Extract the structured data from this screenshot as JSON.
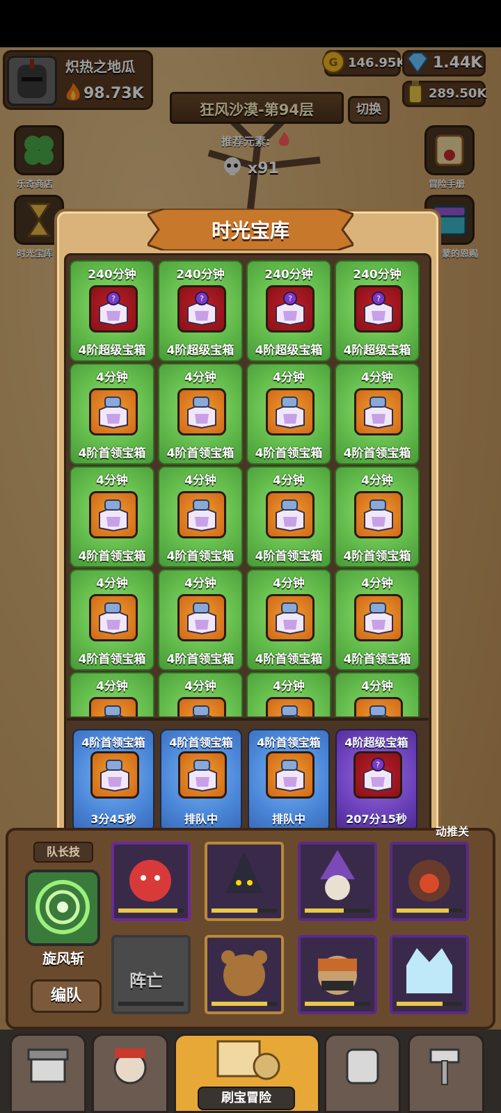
{
  "header": {
    "player_name": "炽热之地瓜",
    "power": "98.73K",
    "gold": "146.95K",
    "gems": "1.44K",
    "potion": "289.50K"
  },
  "stage": {
    "title": "狂风沙漠-第94层",
    "switch_label": "切换",
    "recommend_label": "推荐元素:",
    "skull_count": "x91"
  },
  "side_menu": {
    "left_top": "乐奇商店",
    "left_second": "时光宝库",
    "right_top": "冒险手册",
    "right_second": "卡蒙的恩赐"
  },
  "modal": {
    "title": "时光宝库",
    "grid": [
      {
        "time": "240分钟",
        "name": "4阶超级宝箱",
        "kind": "super"
      },
      {
        "time": "240分钟",
        "name": "4阶超级宝箱",
        "kind": "super"
      },
      {
        "time": "240分钟",
        "name": "4阶超级宝箱",
        "kind": "super"
      },
      {
        "time": "240分钟",
        "name": "4阶超级宝箱",
        "kind": "super"
      },
      {
        "time": "4分钟",
        "name": "4阶首领宝箱",
        "kind": "first"
      },
      {
        "time": "4分钟",
        "name": "4阶首领宝箱",
        "kind": "first"
      },
      {
        "time": "4分钟",
        "name": "4阶首领宝箱",
        "kind": "first"
      },
      {
        "time": "4分钟",
        "name": "4阶首领宝箱",
        "kind": "first"
      },
      {
        "time": "4分钟",
        "name": "4阶首领宝箱",
        "kind": "first"
      },
      {
        "time": "4分钟",
        "name": "4阶首领宝箱",
        "kind": "first"
      },
      {
        "time": "4分钟",
        "name": "4阶首领宝箱",
        "kind": "first"
      },
      {
        "time": "4分钟",
        "name": "4阶首领宝箱",
        "kind": "first"
      },
      {
        "time": "4分钟",
        "name": "4阶首领宝箱",
        "kind": "first"
      },
      {
        "time": "4分钟",
        "name": "4阶首领宝箱",
        "kind": "first"
      },
      {
        "time": "4分钟",
        "name": "4阶首领宝箱",
        "kind": "first"
      },
      {
        "time": "4分钟",
        "name": "4阶首领宝箱",
        "kind": "first"
      },
      {
        "time": "4分钟",
        "name": "",
        "kind": "first"
      },
      {
        "time": "4分钟",
        "name": "",
        "kind": "first"
      },
      {
        "time": "4分钟",
        "name": "",
        "kind": "first"
      },
      {
        "time": "4分钟",
        "name": "",
        "kind": "first"
      }
    ],
    "queue": [
      {
        "name": "4阶首领宝箱",
        "status": "3分45秒",
        "kind": "first",
        "color": "blue"
      },
      {
        "name": "4阶首领宝箱",
        "status": "排队中",
        "kind": "first",
        "color": "blue"
      },
      {
        "name": "4阶首领宝箱",
        "status": "排队中",
        "kind": "first",
        "color": "blue"
      },
      {
        "name": "4阶超级宝箱",
        "status": "207分15秒",
        "kind": "super",
        "color": "purple"
      }
    ]
  },
  "team": {
    "captain_tab": "队长技",
    "skill_name": "旋风斩",
    "team_button": "编队",
    "dead_label": "阵亡",
    "auto_label": "动推关"
  },
  "nav": {
    "active_label": "刷宝冒险"
  },
  "icons": {
    "power": "fire-icon",
    "gold": "gold-coin-icon",
    "gems": "diamond-icon",
    "potion": "potion-icon",
    "skull": "skull-icon",
    "element": "fire-element-icon"
  },
  "colors": {
    "card_green": "#5fb849",
    "queue_blue": "#4a86d8",
    "queue_purple": "#6a40b8",
    "super_frame": "#c0202a",
    "first_frame": "#e08a28"
  }
}
